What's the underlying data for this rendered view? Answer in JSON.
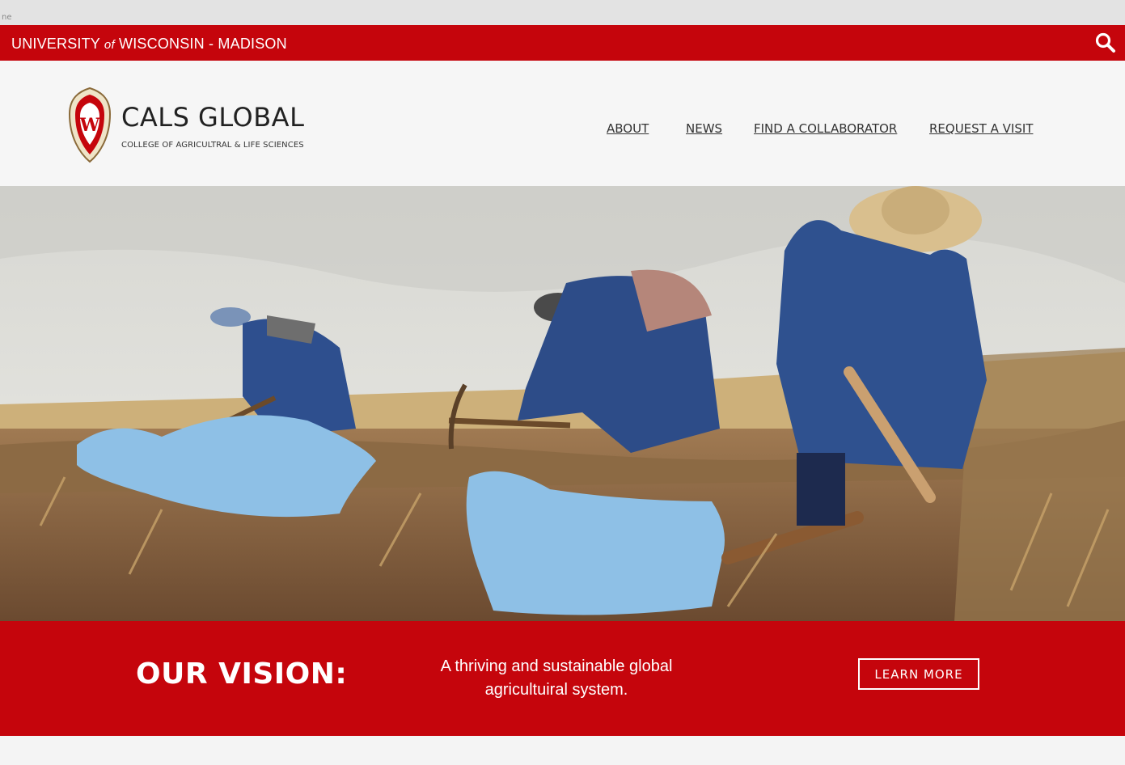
{
  "browser": {
    "tab_fragment": "ne"
  },
  "topbar": {
    "university_prefix": "UNIVERSITY ",
    "university_of": "of",
    "university_suffix": " WISCONSIN - MADISON",
    "accent_color": "#c5050c"
  },
  "header": {
    "crest_letter": "W",
    "title": "CALS GLOBAL",
    "subtitle": "COLLEGE OF AGRICULTRAL & LIFE SCIENCES"
  },
  "nav": {
    "items": [
      {
        "label": "ABOUT"
      },
      {
        "label": "NEWS"
      },
      {
        "label": "FIND A COLLABORATOR"
      },
      {
        "label": "REQUEST A VISIT"
      }
    ]
  },
  "hero": {
    "image_subject": "farmers-harvesting-potatoes"
  },
  "vision": {
    "heading": "OUR VISION:",
    "statement_line1": "A thriving and sustainable global",
    "statement_line2": "agricultuiral system.",
    "button_label": "LEARN MORE"
  },
  "icons": {
    "search": "search-icon",
    "crest": "uw-crest-icon"
  }
}
